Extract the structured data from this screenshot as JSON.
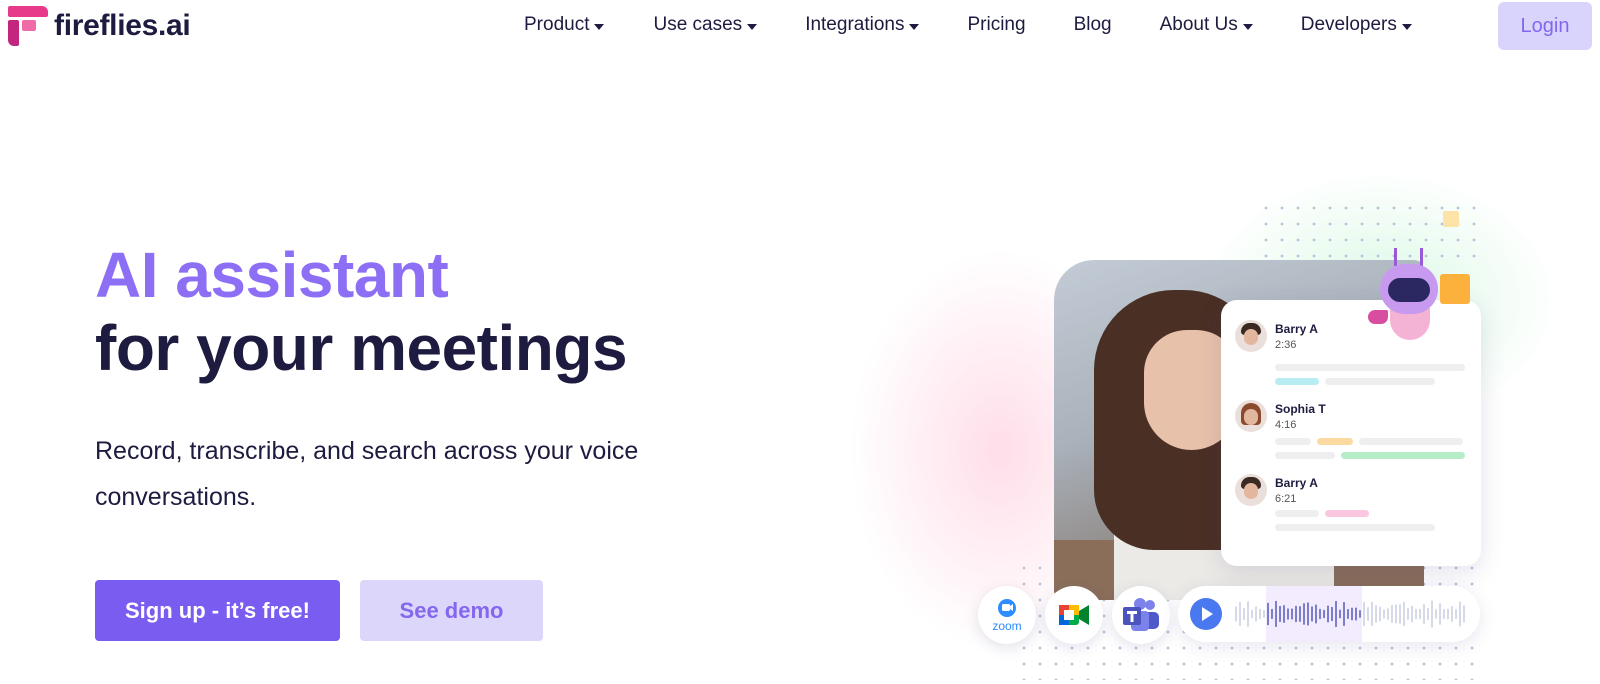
{
  "brand": {
    "logo_text": "fireflies.ai"
  },
  "nav": {
    "items": [
      {
        "label": "Product",
        "dropdown": true
      },
      {
        "label": "Use cases",
        "dropdown": true
      },
      {
        "label": "Integrations",
        "dropdown": true
      },
      {
        "label": "Pricing",
        "dropdown": false
      },
      {
        "label": "Blog",
        "dropdown": false
      },
      {
        "label": "About Us",
        "dropdown": true
      },
      {
        "label": "Developers",
        "dropdown": true
      }
    ],
    "login_label": "Login"
  },
  "hero": {
    "title_line1": "AI assistant",
    "title_line2": "for your meetings",
    "subtitle": "Record, transcribe, and search across your voice conversations.",
    "primary_cta": "Sign up - it’s free!",
    "secondary_cta": "See demo"
  },
  "illustration": {
    "transcript": [
      {
        "name": "Barry A",
        "time": "2:36"
      },
      {
        "name": "Sophia T",
        "time": "4:16"
      },
      {
        "name": "Barry A",
        "time": "6:21"
      }
    ],
    "apps": [
      {
        "name": "zoom",
        "label": "zoom",
        "icon": "zoom-icon"
      },
      {
        "name": "google-meet",
        "icon": "google-meet-icon"
      },
      {
        "name": "microsoft-teams",
        "icon": "teams-icon"
      }
    ]
  },
  "colors": {
    "accent": "#7a5cf0",
    "accent_light": "#dcd6fb",
    "title_purple": "#8c6ff5",
    "dark_text": "#1d1b3f",
    "logo_pink": "#e83a8a"
  }
}
